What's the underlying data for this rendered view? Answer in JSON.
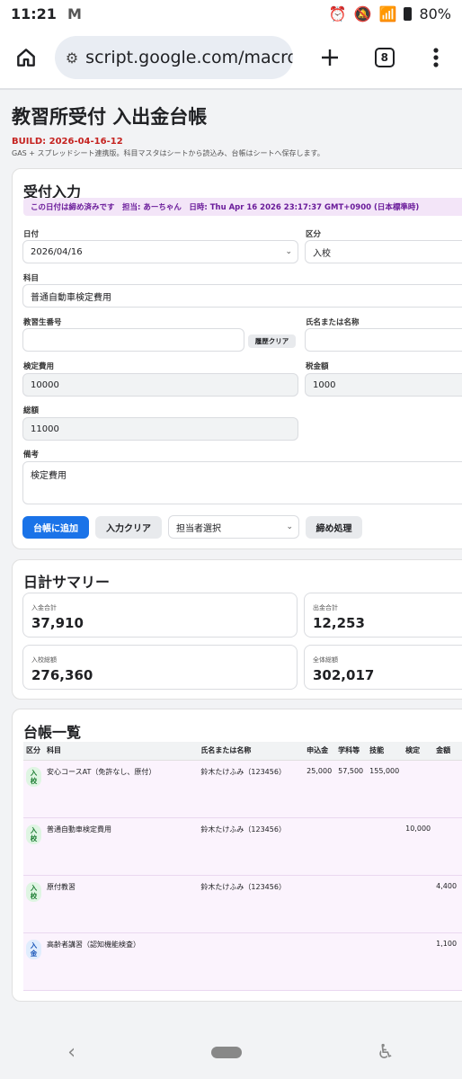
{
  "status": {
    "time": "11:21",
    "mail": "M",
    "battery": "80%"
  },
  "browser": {
    "url": "script.google.com/macro",
    "tab_count": "8"
  },
  "header": {
    "title": "教習所受付 入出金台帳",
    "build": "BUILD: 2026-04-16-12",
    "note": "GAS + スプレッドシート連携版。科目マスタはシートから読込み、台帳はシートへ保存します。"
  },
  "entry": {
    "heading": "受付入力",
    "notice": "この日付は締め済みです　担当: あーちゃん　日時: Thu Apr 16 2026 23:17:37 GMT+0900 (日本標準時)",
    "date_label": "日付",
    "date_value": "2026/04/16",
    "kubun_label": "区分",
    "kubun_value": "入校",
    "subject_label": "科目",
    "subject_value": "普通自動車検定費用",
    "student_label": "教習生番号",
    "student_value": "",
    "history_clear": "履歴クリア",
    "name_label": "氏名または名称",
    "name_value": "",
    "fee_label": "検定費用",
    "fee_value": "10000",
    "tax_label": "税金額",
    "tax_value": "1000",
    "total_label": "総額",
    "total_value": "11000",
    "memo_label": "備考",
    "memo_value": "検定費用",
    "add_button": "台帳に追加",
    "clear_button": "入力クリア",
    "staff_select": "担当者選択",
    "close_button": "締め処理"
  },
  "summary": {
    "heading": "日計サマリー",
    "stats": [
      {
        "label": "入金合計",
        "value": "37,910"
      },
      {
        "label": "出金合計",
        "value": "12,253"
      },
      {
        "label": "入校総額",
        "value": "276,360"
      },
      {
        "label": "全体総額",
        "value": "302,017"
      }
    ]
  },
  "ledger": {
    "heading": "台帳一覧",
    "columns": [
      "区分",
      "科目",
      "氏名または名称",
      "申込金",
      "学科等",
      "技能",
      "検定",
      "金額"
    ],
    "rows": [
      {
        "kubun": "入校",
        "subject": "安心コースAT（免許なし、原付）",
        "name": "鈴木たけふみ（123456）",
        "moushikomi": "25,000",
        "gakka": "57,500",
        "ginou": "155,000",
        "kentei": "",
        "amount": ""
      },
      {
        "kubun": "入校",
        "subject": "普通自動車検定費用",
        "name": "鈴木たけふみ（123456）",
        "moushikomi": "",
        "gakka": "",
        "ginou": "",
        "kentei": "10,000",
        "amount": ""
      },
      {
        "kubun": "入校",
        "subject": "原付教習",
        "name": "鈴木たけふみ（123456）",
        "moushikomi": "",
        "gakka": "",
        "ginou": "",
        "kentei": "",
        "amount": "4,400"
      },
      {
        "kubun": "入金",
        "subject": "高齢者講習（認知機能検査）",
        "name": "",
        "moushikomi": "",
        "gakka": "",
        "ginou": "",
        "kentei": "",
        "amount": "1,100"
      }
    ]
  }
}
